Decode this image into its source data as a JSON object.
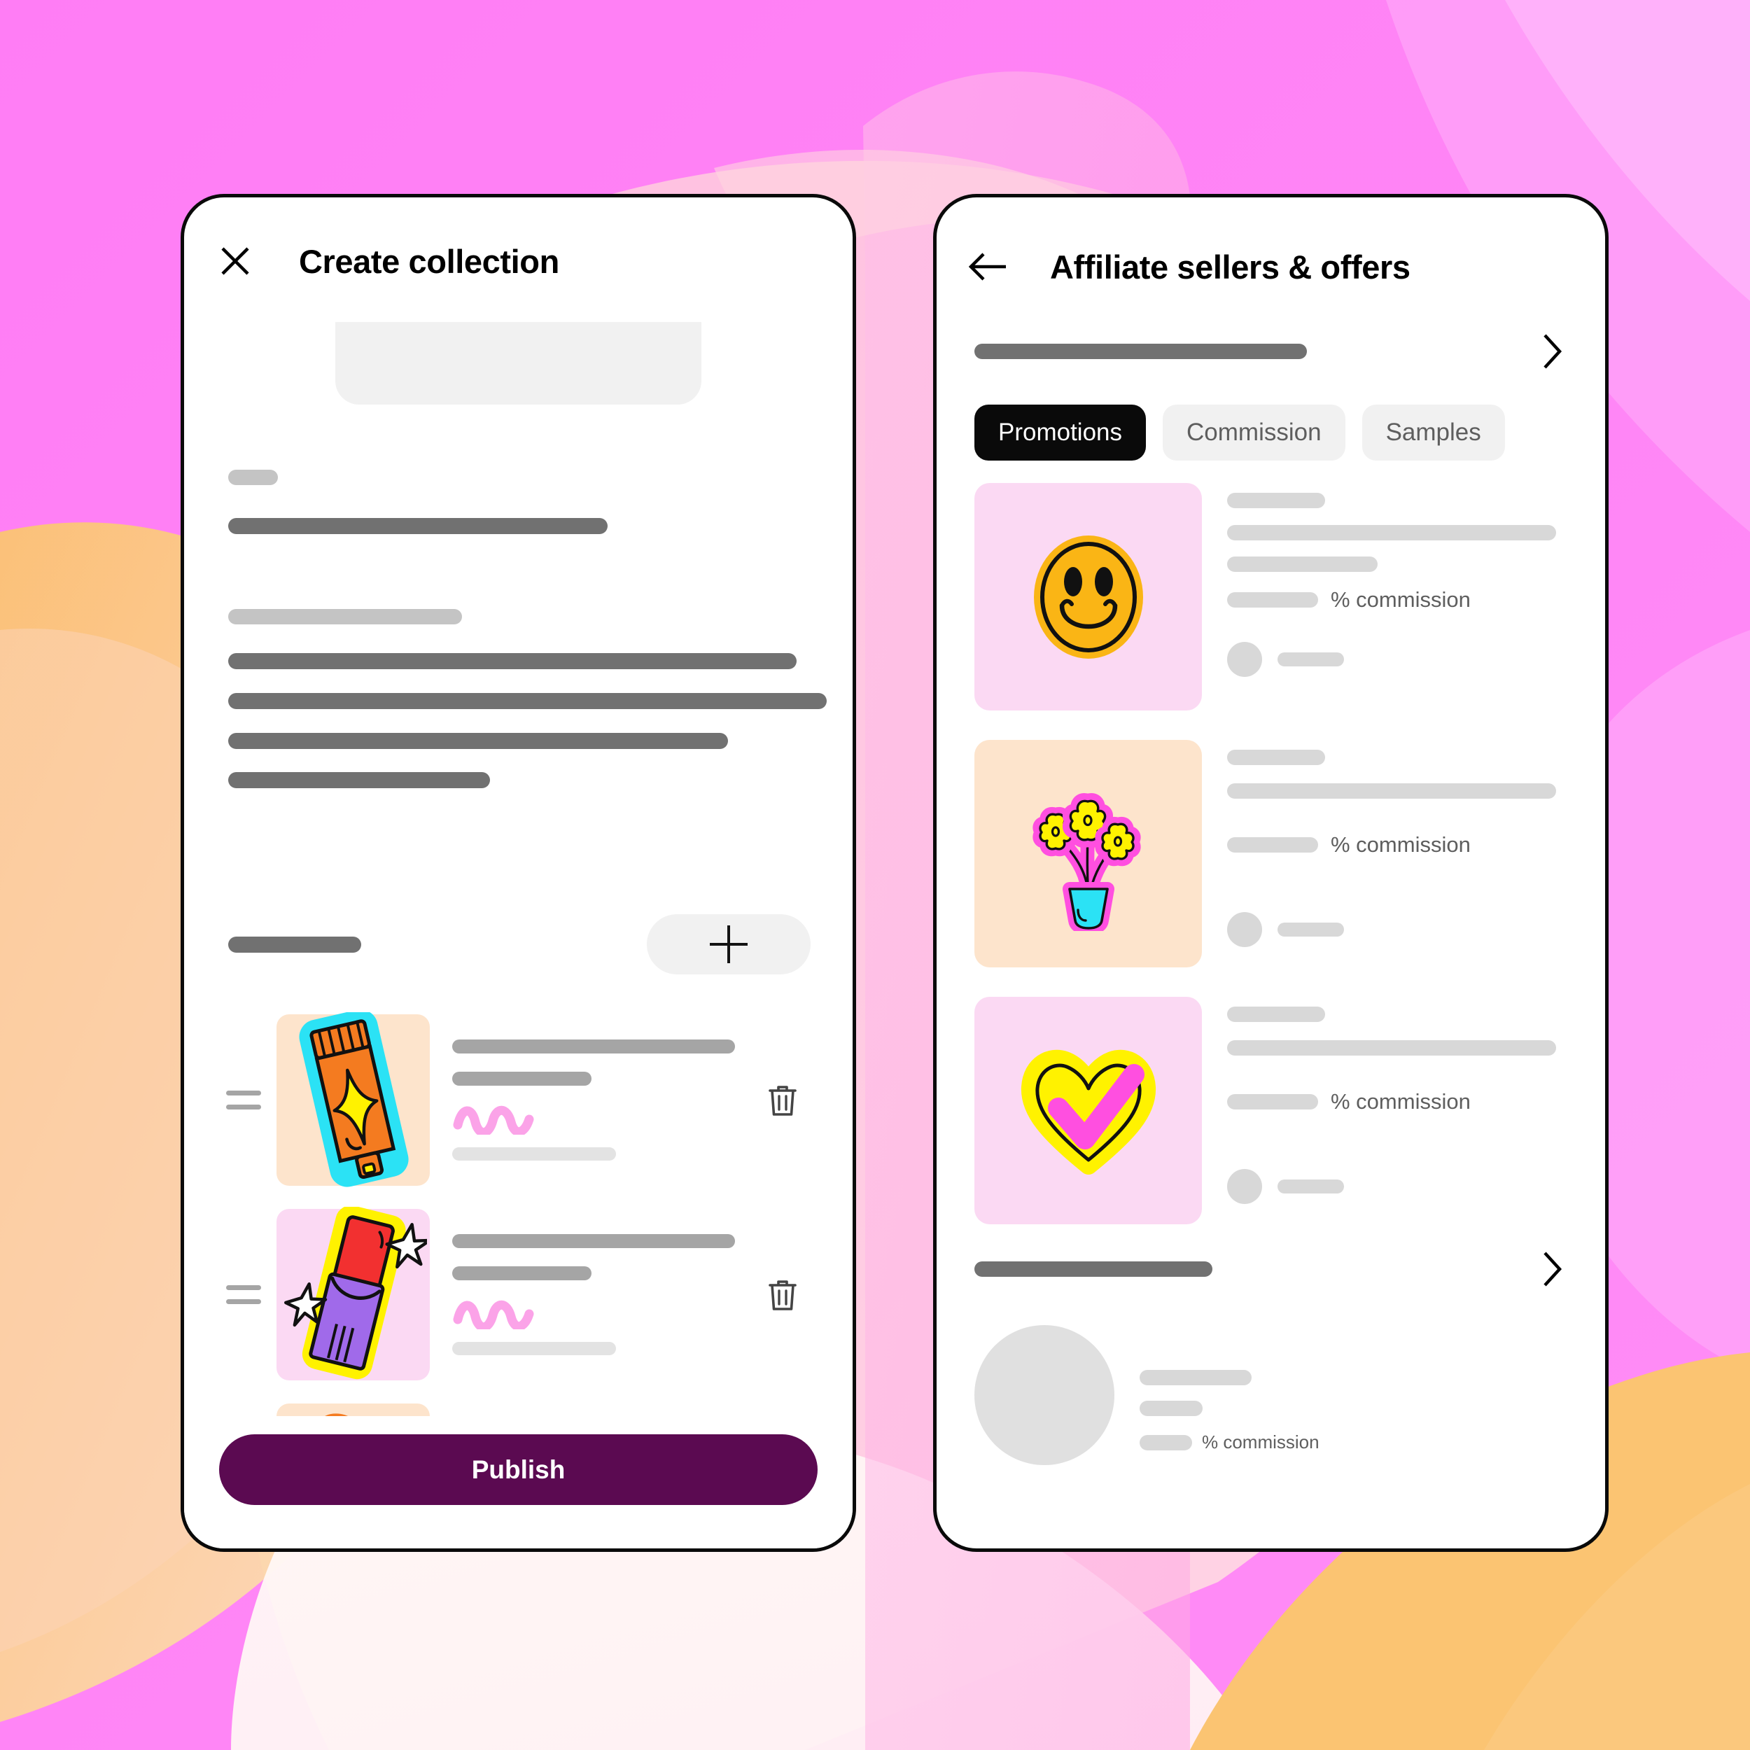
{
  "background": {
    "base_color": "#FF7DF5",
    "magenta": "#FF7DF5",
    "magenta_light": "#FFA8F8",
    "pink_pale": "#FFC8DE",
    "pink_blush": "#FDD3D7",
    "peach": "#FBCBAE",
    "orange": "#FBC472",
    "white_wash": "#FFF6F4"
  },
  "phone_left": {
    "close_icon": "close-icon",
    "title": "Create collection",
    "cover_placeholder": "image-upload-placeholder",
    "form": {
      "field1_label_skeleton": "skeleton-label",
      "field1_value_skeleton": "skeleton-value",
      "field2_label_skeleton": "skeleton-label",
      "field2_lines": 4
    },
    "items_section": {
      "label_skeleton": "skeleton-section-label",
      "add_button_icon": "plus-icon"
    },
    "products": [
      {
        "thumb_bg": "#FDE4CC",
        "art": "sunscreen-tube",
        "art_outline": "#2BE2F5",
        "art_body": "#F47B20",
        "art_accent": "#FFF200",
        "drag_handle_icon": "drag-handle-icon",
        "delete_icon": "trash-icon",
        "squiggle_color": "#FBA3E8"
      },
      {
        "thumb_bg": "#FBD9F3",
        "art": "lipstick",
        "art_outline": "#FFF200",
        "art_body": "#A06AEA",
        "art_accent": "#F23030",
        "drag_handle_icon": "drag-handle-icon",
        "delete_icon": "trash-icon",
        "squiggle_color": "#FBA3E8"
      },
      {
        "thumb_bg": "#FDE4CC",
        "art": "makeup-brushes",
        "art_outline": "#F47B20",
        "art_body": "#2BE2F5",
        "art_accent": "#FFF200",
        "drag_handle_icon": "drag-handle-icon",
        "delete_icon": "trash-icon",
        "squiggle_color": "#FBA3E8"
      }
    ],
    "publish_label": "Publish",
    "publish_color": "#5B0A51"
  },
  "phone_right": {
    "back_icon": "back-arrow-icon",
    "title": "Affiliate sellers & offers",
    "section_header": {
      "title_skeleton": "skeleton-section-title",
      "chevron_icon": "chevron-right-icon"
    },
    "tabs": [
      {
        "label": "Promotions",
        "active": true
      },
      {
        "label": "Commission",
        "active": false
      },
      {
        "label": "Samples",
        "active": false
      }
    ],
    "offers": [
      {
        "thumb_bg": "#FBD9F3",
        "art": "smiley-face",
        "art_fill": "#FAB515",
        "lines": 3,
        "commission_label": "% commission",
        "seller_avatar": "avatar-placeholder"
      },
      {
        "thumb_bg": "#FDE4CC",
        "art": "flower-pot",
        "art_fill": "#FF4FE0",
        "lines": 2,
        "commission_label": "% commission",
        "seller_avatar": "avatar-placeholder"
      },
      {
        "thumb_bg": "#FBD9F3",
        "art": "heart-check",
        "art_fill": "#FFF200",
        "lines": 2,
        "commission_label": "% commission",
        "seller_avatar": "avatar-placeholder"
      }
    ],
    "section_header_2": {
      "title_skeleton": "skeleton-section-title",
      "chevron_icon": "chevron-right-icon"
    },
    "featured_seller": {
      "avatar": "avatar-placeholder",
      "name_skeleton": "skeleton-name",
      "sub_skeleton": "skeleton-sub",
      "commission_label": "% commission"
    }
  }
}
